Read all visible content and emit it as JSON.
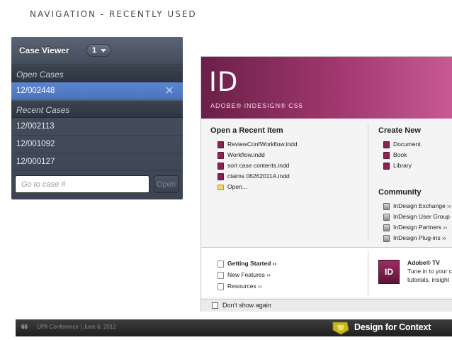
{
  "slide": {
    "title": "NAVIGATION -  RECENTLY USED"
  },
  "case_viewer": {
    "title": "Case Viewer",
    "count": "1",
    "open_cases_label": "Open Cases",
    "open_cases": [
      "12/002448"
    ],
    "recent_cases_label": "Recent Cases",
    "recent_cases": [
      "12/002113",
      "12/001092",
      "12/000127"
    ],
    "search_placeholder": "Go to case #",
    "open_button": "Open"
  },
  "indesign": {
    "logo": "ID",
    "product_name": "ADOBE® INDESIGN® CS5",
    "open_recent": {
      "heading": "Open a Recent Item",
      "items": [
        "ReviewConfWorkflow.indd",
        "Workflow.indd",
        "sort case contents.indd",
        "claims 06262011A.indd",
        "Open..."
      ]
    },
    "create_new": {
      "heading": "Create New",
      "items": [
        "Document",
        "Book",
        "Library"
      ]
    },
    "community": {
      "heading": "Community",
      "items": [
        "InDesign Exchange ››",
        "InDesign User Group",
        "InDesign Partners ››",
        "InDesign Plug-ins ››"
      ]
    },
    "help_links": [
      "Getting Started ››",
      "New Features ››",
      "Resources ››"
    ],
    "tv": {
      "icon": "ID",
      "title": "Adobe® TV",
      "line1": "Tune in to your c",
      "line2": "tutorials, insight"
    },
    "dont_show": "Don't show again"
  },
  "footer": {
    "page_number": "66",
    "conference": "UPA Conference  |  June 6, 2012",
    "brand": "Design for Context"
  },
  "colors": {
    "selection": "#4f7bc6",
    "indesign_magenta": "#a1386f",
    "brand_logo": "#c7b820"
  }
}
